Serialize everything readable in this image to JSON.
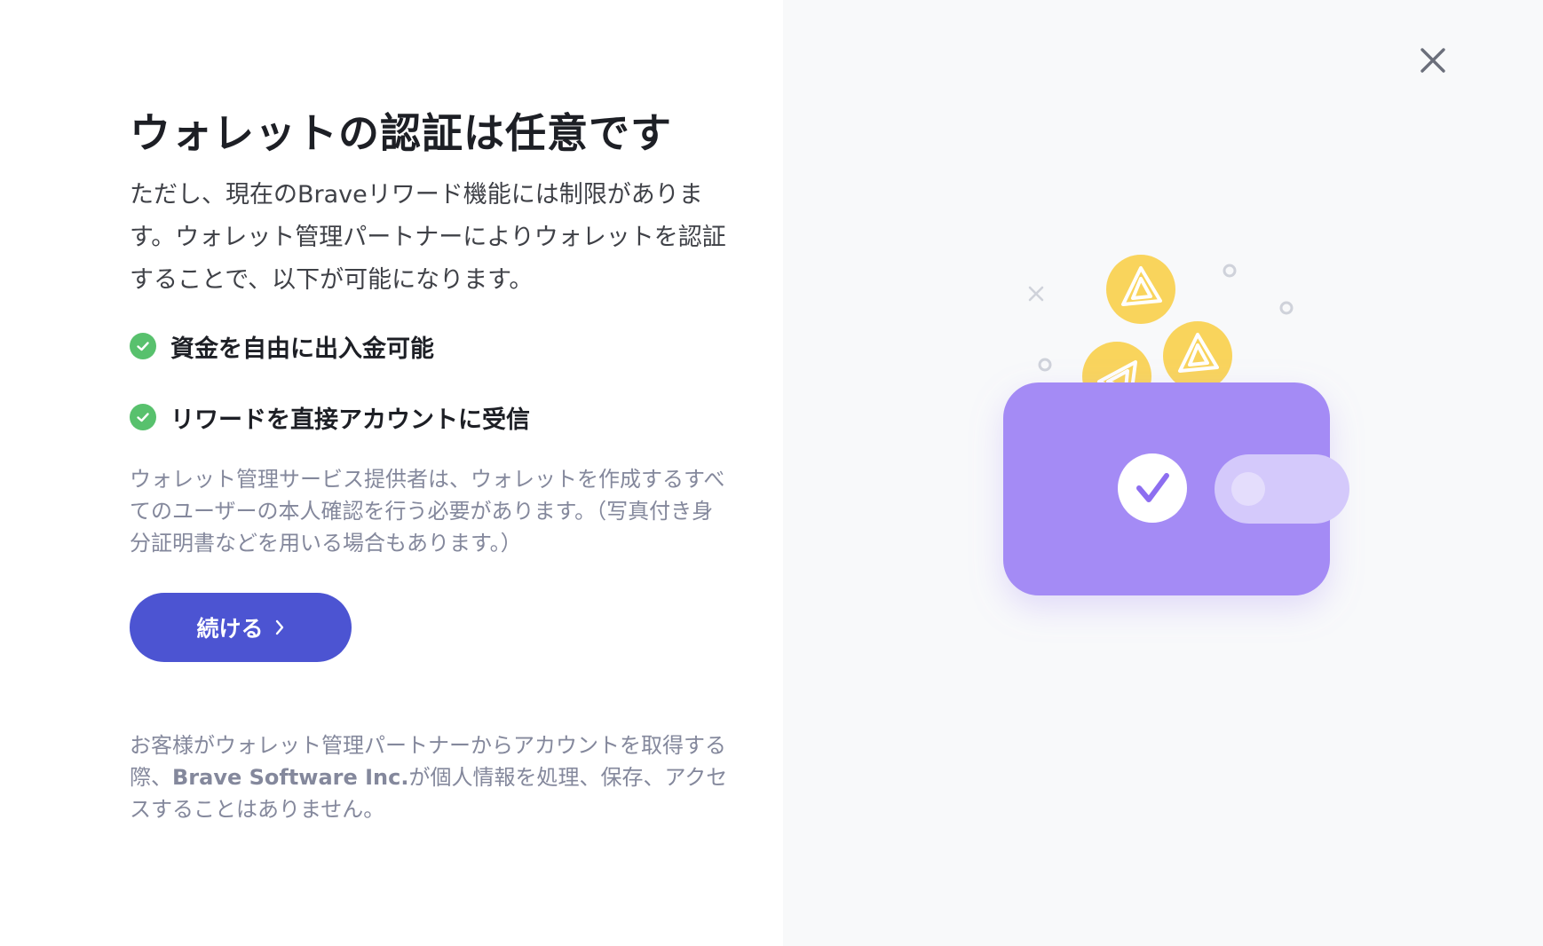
{
  "modal": {
    "title": "ウォレットの認証は任意です",
    "lead": "ただし、現在のBraveリワード機能には制限があります。ウォレット管理パートナーによりウォレットを認証することで、以下が可能になります。",
    "benefits": [
      {
        "label": "資金を自由に出入金可能",
        "icon": "check-circle-icon"
      },
      {
        "label": "リワードを直接アカウントに受信",
        "icon": "check-circle-icon"
      }
    ],
    "note": "ウォレット管理サービス提供者は、ウォレットを作成するすべてのユーザーの本人確認を行う必要があります。（写真付き身分証明書などを用いる場合もあります。）",
    "continue_button": {
      "label": "続ける",
      "icon": "chevron-right-icon"
    },
    "footer": {
      "prefix": "お客様がウォレット管理パートナーからアカウントを取得する際、",
      "company": "Brave Software Inc.",
      "suffix": "が個人情報を処理、保存、アクセスすることはありません。"
    },
    "close_icon": "close-icon"
  },
  "illustration": {
    "icon": "wallet-verified-illustration",
    "colors": {
      "wallet": "#a48bf5",
      "wallet_tab": "#d4c9fb",
      "coin": "#f9d45c",
      "check": "#8d6ef0",
      "accent_primary": "#4c54d2",
      "success": "#58c16d"
    }
  }
}
